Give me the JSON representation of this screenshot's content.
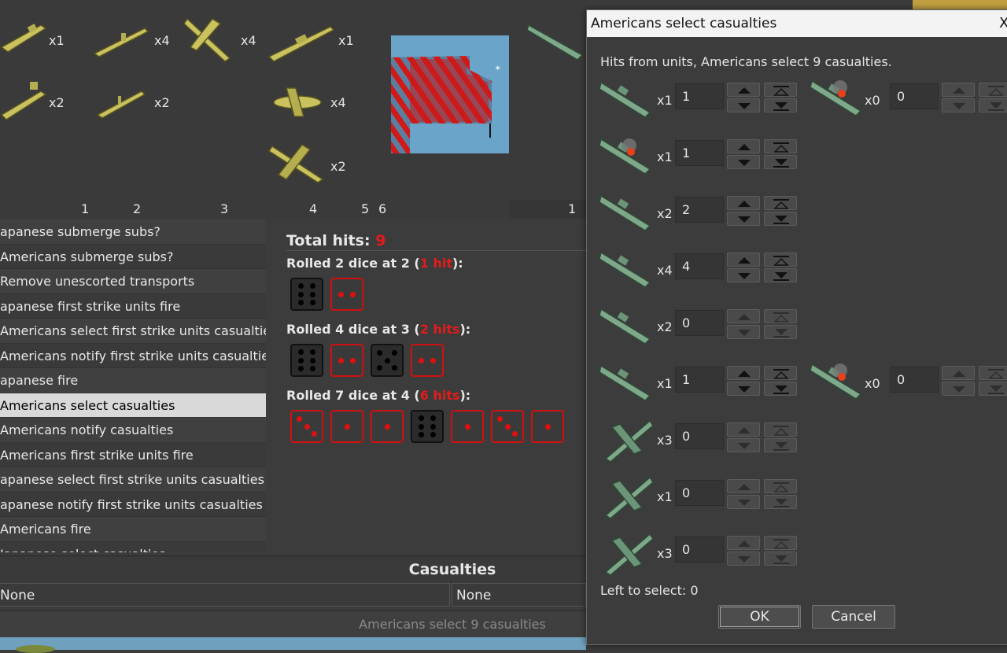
{
  "top_units_left": [
    {
      "icon": "transport-ship-icon",
      "count": "x1"
    },
    {
      "icon": "submarine-icon",
      "count": "x4"
    },
    {
      "icon": "fighter-plane-icon",
      "count": "x4"
    },
    {
      "icon": "battleship-icon",
      "count": "x1"
    },
    {
      "icon": "transport-ship-icon",
      "count": "x2"
    },
    {
      "icon": "destroyer-icon",
      "count": "x2"
    },
    {
      "icon": "tactical-bomber-icon",
      "count": "x4"
    },
    {
      "icon": "bomber-plane-icon",
      "count": "x2"
    }
  ],
  "top_columns_left": [
    "1",
    "2",
    "3",
    "4",
    "5",
    "6"
  ],
  "top_columns_right": [
    "1"
  ],
  "steps": [
    "apanese submerge subs?",
    "Americans submerge subs?",
    "Remove unescorted transports",
    "apanese first strike units fire",
    "Americans select first strike units casualties",
    "Americans notify first strike units casualties",
    "apanese fire",
    "Americans select casualties",
    "Americans notify casualties",
    "Americans first strike units fire",
    "apanese select first strike units casualties",
    "apanese notify first strike units casualties",
    "Americans fire",
    "Japanese select casualties"
  ],
  "selected_step_index": 7,
  "dice": {
    "total_label": "Total hits:",
    "total_value": "9",
    "rolls": [
      {
        "prefix": "Rolled 2 dice at 2 (",
        "hits": "1 hit",
        "suffix": "):",
        "dice": [
          {
            "v": 6,
            "hit": false
          },
          {
            "v": 2,
            "hit": true
          }
        ]
      },
      {
        "prefix": "Rolled 4 dice at 3 (",
        "hits": "2 hits",
        "suffix": "):",
        "dice": [
          {
            "v": 6,
            "hit": false
          },
          {
            "v": 2,
            "hit": true
          },
          {
            "v": 5,
            "hit": false
          },
          {
            "v": 2,
            "hit": true
          }
        ]
      },
      {
        "prefix": "Rolled 7 dice at 4 (",
        "hits": "6 hits",
        "suffix": "):",
        "dice": [
          {
            "v": 3,
            "hit": true
          },
          {
            "v": 1,
            "hit": true
          },
          {
            "v": 1,
            "hit": true
          },
          {
            "v": 6,
            "hit": false
          },
          {
            "v": 1,
            "hit": true
          },
          {
            "v": 3,
            "hit": true
          },
          {
            "v": 1,
            "hit": true
          }
        ]
      }
    ]
  },
  "casualties": {
    "header": "Casualties",
    "left": "None",
    "right": "None"
  },
  "status_bar": "Americans select 9 casualties",
  "dialog": {
    "title": "Americans select casualties",
    "close_glyph": "X",
    "instructions": "Hits from units,  Americans select 9 casualties.",
    "rows": [
      {
        "icon": "us-transport-icon",
        "count": "x1",
        "value": "1",
        "active": true
      },
      {
        "icon": "damaged-transport-icon",
        "count": "x1",
        "value": "1",
        "active": true
      },
      {
        "icon": "us-submarine-icon",
        "count": "x2",
        "value": "2",
        "active": true
      },
      {
        "icon": "us-destroyer-icon",
        "count": "x4",
        "value": "4",
        "active": true
      },
      {
        "icon": "us-cruiser-icon",
        "count": "x2",
        "value": "0",
        "active": false
      },
      {
        "icon": "us-battleship-icon",
        "count": "x1",
        "value": "1",
        "active": true
      },
      {
        "icon": "us-fighter-icon",
        "count": "x3",
        "value": "0",
        "active": false
      },
      {
        "icon": "us-fighter-icon",
        "count": "x1",
        "value": "0",
        "active": false
      },
      {
        "icon": "us-bomber-icon",
        "count": "x3",
        "value": "0",
        "active": false
      }
    ],
    "side_rows": [
      {
        "icon": "damaged-transport-icon",
        "count": "x0",
        "value": "0"
      },
      {
        "icon": "burning-battleship-icon",
        "count": "x0",
        "value": "0"
      }
    ],
    "left_to_select": "Left to select: 0",
    "ok": "OK",
    "cancel": "Cancel"
  },
  "colors": {
    "hit": "#e41b1b",
    "jp_unit": "#c9c25e",
    "us_unit": "#7fa88a"
  }
}
